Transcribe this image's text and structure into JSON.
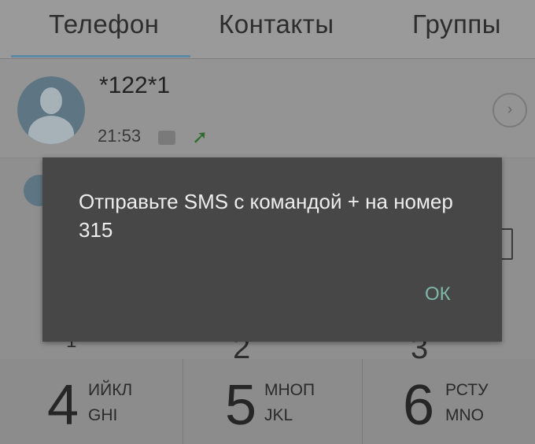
{
  "tabs": [
    {
      "label": "Телефон"
    },
    {
      "label": "Контакты"
    },
    {
      "label": "Группы"
    }
  ],
  "call_log": {
    "entry": {
      "number": "*122*1",
      "time": "21:53"
    }
  },
  "behind_dialog": {
    "digit_left": "1",
    "digit_mid": "2",
    "digit_right": "3"
  },
  "keypad": [
    {
      "digit": "4",
      "letters_ru": "ИЙКЛ",
      "letters_en": "GHI"
    },
    {
      "digit": "5",
      "letters_ru": "МНОП",
      "letters_en": "JKL"
    },
    {
      "digit": "6",
      "letters_ru": "РСТУ",
      "letters_en": "MNO"
    }
  ],
  "dialog": {
    "message": "Отправьте SMS с командой + на номер 315",
    "ok_label": "ОК"
  },
  "colors": {
    "accent": "#5d8aa3",
    "dialog_bg": "#474747",
    "ok_text": "#7fb8a8",
    "call_arrow": "#2f6a2f"
  }
}
